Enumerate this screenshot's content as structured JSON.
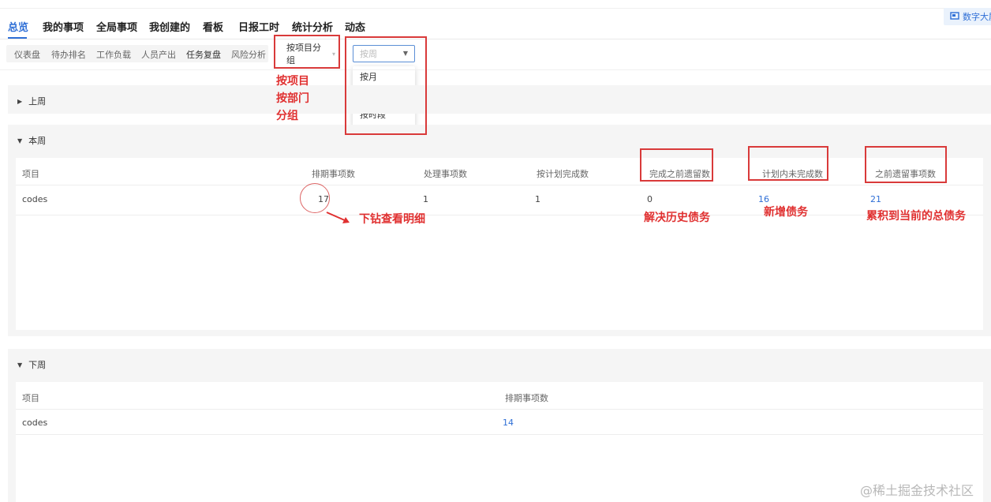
{
  "top_tabs": [
    "总览",
    "我的事项",
    "全局事项",
    "我创建的",
    "看板",
    "日报工时",
    "统计分析",
    "动态"
  ],
  "big_screen_label": "数字大屏",
  "sub_tabs": [
    "仪表盘",
    "待办排名",
    "工作负载",
    "人员产出",
    "任务复盘",
    "风险分析"
  ],
  "group_select": "按项目分组",
  "period_placeholder": "按周",
  "period_options": [
    "按月",
    "按周",
    "按时段"
  ],
  "annotations": {
    "group_options": [
      "按项目",
      "按部门",
      "分组"
    ],
    "drill": "下钻查看明细",
    "resolve": "解决历史债务",
    "new_debt": "新增债务",
    "total_debt": "累积到当前的总债务"
  },
  "last_week": {
    "title": "上周"
  },
  "this_week": {
    "title": "本周",
    "headers": [
      "项目",
      "排期事项数",
      "处理事项数",
      "按计划完成数",
      "完成之前遗留数",
      "计划内未完成数",
      "之前遗留事项数"
    ],
    "rows": [
      [
        "codes",
        "17",
        "1",
        "1",
        "0",
        "16",
        "21"
      ]
    ]
  },
  "next_week": {
    "title": "下周",
    "headers": [
      "项目",
      "排期事项数"
    ],
    "rows": [
      [
        "codes",
        "14"
      ]
    ]
  },
  "watermark": "@稀土掘金技术社区",
  "colors": {
    "accent": "#2f6fd6",
    "annotation": "#e03030"
  }
}
